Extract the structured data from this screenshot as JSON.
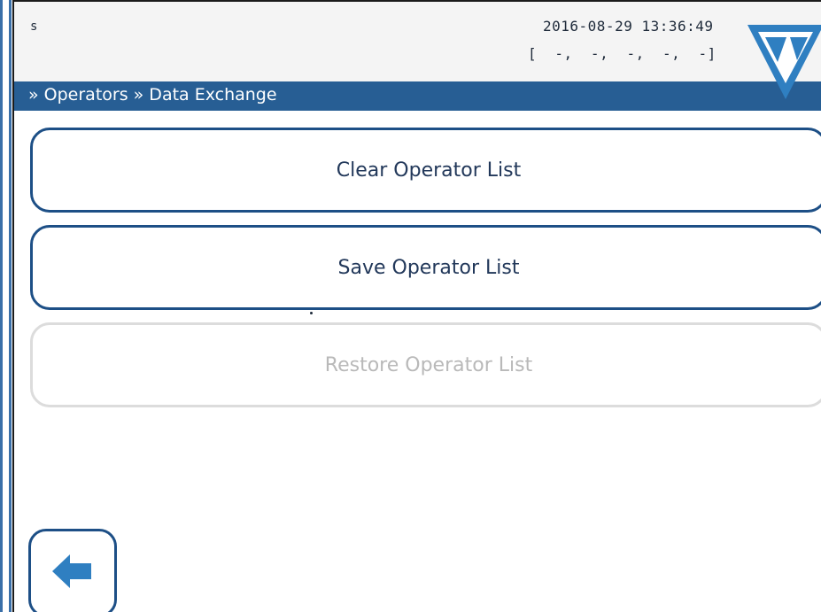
{
  "status": {
    "left_text": "s",
    "datetime": "2016-08-29 13:36:49",
    "readings": "[  -,  -,  -,  -,  -]"
  },
  "breadcrumb": {
    "text": "» Operators » Data Exchange"
  },
  "menu": {
    "clear_label": "Clear Operator List",
    "save_label": "Save Operator List",
    "restore_label": "Restore Operator List"
  },
  "icons": {
    "logo": "brand-logo-icon",
    "back": "back-arrow-icon"
  },
  "colors": {
    "accent": "#275e94",
    "button_border": "#1d4f86",
    "disabled": "#dcdcdc"
  }
}
